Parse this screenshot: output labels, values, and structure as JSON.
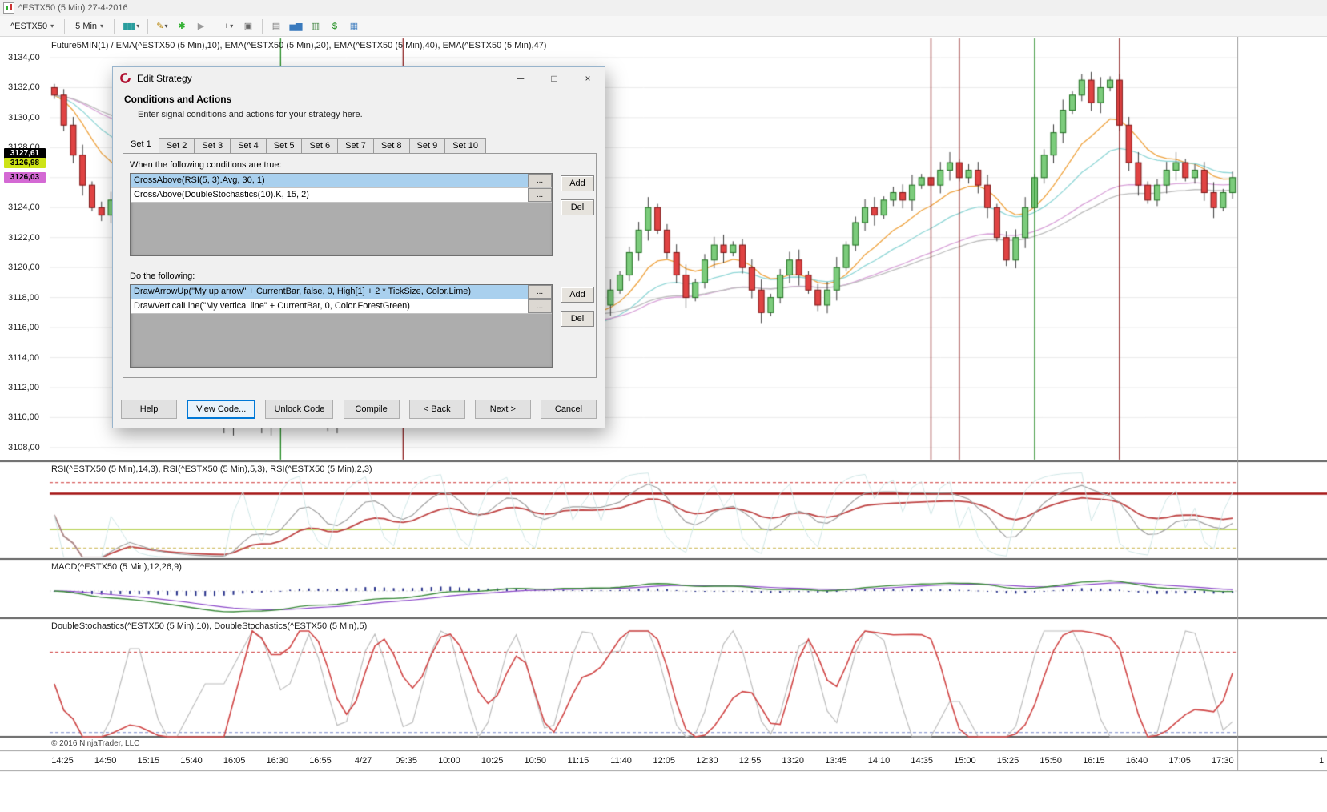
{
  "window": {
    "title": "^ESTX50 (5 Min)  27-4-2016"
  },
  "toolbar": {
    "instrument": "^ESTX50",
    "interval": "5 Min",
    "caret": "▾",
    "icons": [
      {
        "sep": true
      },
      {
        "name": "chart-style-button",
        "glyph": "▮▮▮",
        "color": "#2a9d9d",
        "caret": true
      },
      {
        "sep": true
      },
      {
        "name": "drawing-tools-button",
        "glyph": "✎",
        "color": "#b8860b",
        "caret": true
      },
      {
        "name": "add-indicator-button",
        "glyph": "✱",
        "color": "#2eaf2e",
        "caret": false
      },
      {
        "name": "pointer-button",
        "glyph": "▶",
        "color": "#9a9a9a",
        "caret": false
      },
      {
        "sep": true
      },
      {
        "name": "crosshair-button",
        "glyph": "+",
        "color": "#333333",
        "caret": true
      },
      {
        "name": "snapshot-button",
        "glyph": "▣",
        "color": "#666666",
        "caret": false
      },
      {
        "sep": true
      },
      {
        "name": "window-layout-button",
        "glyph": "▤",
        "color": "#777777",
        "caret": false
      },
      {
        "name": "bar-analyzer-button",
        "glyph": "▅▆",
        "color": "#3a7abd",
        "caret": false
      },
      {
        "name": "export-chart-button",
        "glyph": "▥",
        "color": "#4a8a4a",
        "caret": false
      },
      {
        "name": "chart-trader-button",
        "glyph": "$",
        "color": "#1c8c1c",
        "caret": false
      },
      {
        "name": "data-grid-button",
        "glyph": "▦",
        "color": "#3a7abd",
        "caret": false
      }
    ]
  },
  "chart": {
    "overlay_label": "Future5MIN(1) / EMA(^ESTX50 (5 Min),10), EMA(^ESTX50 (5 Min),20), EMA(^ESTX50 (5 Min),40), EMA(^ESTX50 (5 Min),47)",
    "rsi_label": "RSI(^ESTX50 (5 Min),14,3), RSI(^ESTX50 (5 Min),5,3), RSI(^ESTX50 (5 Min),2,3)",
    "macd_label": "MACD(^ESTX50 (5 Min),12,26,9)",
    "stoch_label": "DoubleStochastics(^ESTX50 (5 Min),10), DoubleStochastics(^ESTX50 (5 Min),5)",
    "copyright": "© 2016 NinjaTrader, LLC",
    "price_axis": [
      "3134,00",
      "3132,00",
      "3130,00",
      "3128,00",
      "3126,00",
      "3124,00",
      "3122,00",
      "3120,00",
      "3118,00",
      "3116,00",
      "3114,00",
      "3112,00",
      "3110,00",
      "3108,00"
    ],
    "price_markers": [
      {
        "label": "3127,61",
        "value": 3127.61,
        "bg": "#000000",
        "fg": "#ffffff"
      },
      {
        "label": "3126,98",
        "value": 3126.98,
        "bg": "#cde317",
        "fg": "#000000"
      },
      {
        "label": "3126,03",
        "value": 3126.03,
        "bg": "#d469d4",
        "fg": "#000000"
      }
    ],
    "time_axis": [
      "14:25",
      "14:50",
      "15:15",
      "15:40",
      "16:05",
      "16:30",
      "16:55",
      "4/27",
      "09:35",
      "10:00",
      "10:25",
      "10:50",
      "11:15",
      "11:40",
      "12:05",
      "12:30",
      "12:55",
      "13:20",
      "13:45",
      "14:10",
      "14:35",
      "15:00",
      "15:25",
      "15:50",
      "16:15",
      "16:40",
      "17:05",
      "17:30",
      "1"
    ]
  },
  "dialog": {
    "title": "Edit Strategy",
    "controls": [
      "─",
      "□",
      "×"
    ],
    "heading": "Conditions and Actions",
    "subheading": "Enter signal conditions and actions for your strategy here.",
    "tabs": [
      "Set 1",
      "Set 2",
      "Set 3",
      "Set 4",
      "Set 5",
      "Set 6",
      "Set 7",
      "Set 8",
      "Set 9",
      "Set 10"
    ],
    "active_tab": "Set 1",
    "conditions_label": "When the following conditions are true:",
    "conditions": [
      "CrossAbove(RSI(5, 3).Avg, 30, 1)",
      "CrossAbove(DoubleStochastics(10).K, 15, 2)"
    ],
    "actions_label": "Do the following:",
    "actions": [
      "DrawArrowUp(\"My up arrow\" + CurrentBar, false, 0, High[1] + 2 * TickSize, Color.Lime)",
      "DrawVerticalLine(\"My vertical line\" + CurrentBar, 0, Color.ForestGreen)"
    ],
    "row_button": "...",
    "add_label": "Add",
    "del_label": "Del",
    "footer_buttons": [
      "Help",
      "View Code...",
      "Unlock Code",
      "Compile",
      "< Back",
      "Next >",
      "Cancel"
    ]
  },
  "chart_data": {
    "type": "candlestick+indicators",
    "ylim": [
      3108,
      3134
    ],
    "closes": [
      3131.5,
      3129.5,
      3127.5,
      3125.5,
      3124.0,
      3123.5,
      3124.5,
      3124.0,
      3123.0,
      3121.5,
      3120.0,
      3118.5,
      3117.0,
      3115.5,
      3114.0,
      3112.5,
      3111.0,
      3110.0,
      3109.5,
      3110.5,
      3111.5,
      3110.5,
      3109.5,
      3110.0,
      3111.0,
      3112.5,
      3113.5,
      3112.0,
      3110.5,
      3109.5,
      3110.5,
      3112.0,
      3113.0,
      3114.5,
      3113.5,
      3112.0,
      3111.0,
      3112.0,
      3113.5,
      3115.0,
      3116.5,
      3117.5,
      3116.5,
      3115.0,
      3114.0,
      3115.0,
      3116.5,
      3117.5,
      3118.5,
      3117.5,
      3116.0,
      3115.0,
      3116.0,
      3117.0,
      3118.0,
      3117.0,
      3117.5,
      3118.0,
      3117.5,
      3118.5,
      3119.5,
      3121.0,
      3122.5,
      3124.0,
      3122.5,
      3121.0,
      3119.5,
      3118.0,
      3119.0,
      3120.5,
      3121.5,
      3121.0,
      3121.5,
      3120.0,
      3118.5,
      3117.0,
      3118.0,
      3119.5,
      3120.5,
      3119.5,
      3118.5,
      3117.5,
      3118.5,
      3120.0,
      3121.5,
      3123.0,
      3124.0,
      3123.5,
      3124.5,
      3125.0,
      3124.5,
      3125.5,
      3126.0,
      3125.5,
      3126.5,
      3127.0,
      3126.0,
      3126.5,
      3125.5,
      3124.0,
      3122.0,
      3120.5,
      3122.0,
      3124.0,
      3126.0,
      3127.5,
      3129.0,
      3130.5,
      3131.5,
      3132.5,
      3131.0,
      3132.0,
      3132.5,
      3129.5,
      3127.0,
      3125.5,
      3124.5,
      3125.5,
      3126.5,
      3127.0,
      3126.0,
      3126.5,
      3125.0,
      3124.0,
      3125.0,
      3126.0
    ],
    "candle_up": {
      "fill": "#7ccc7c",
      "stroke": "#1f6f1f"
    },
    "candle_down": {
      "fill": "#e04343",
      "stroke": "#7a1212"
    },
    "wick_color": "#3a3a3a",
    "emas": [
      {
        "period": 10,
        "color": "#efa33f"
      },
      {
        "period": 20,
        "color": "#8fd6d6"
      },
      {
        "period": 40,
        "color": "#d9a3d9"
      },
      {
        "period": 47,
        "color": "#bdbdbd"
      }
    ],
    "vertical_lines": [
      {
        "index": 24,
        "color": "#228b22"
      },
      {
        "index": 37,
        "color": "#8b1a1a"
      },
      {
        "index": 93,
        "color": "#8b1a1a"
      },
      {
        "index": 96,
        "color": "#8b1a1a"
      },
      {
        "index": 104,
        "color": "#228b22"
      },
      {
        "index": 113,
        "color": "#8b1a1a"
      }
    ],
    "rsi_series": [
      {
        "period": 14,
        "smooth": 3,
        "color": "#bf4545",
        "width": 1.8
      },
      {
        "period": 5,
        "smooth": 3,
        "color": "#9e9e9e",
        "width": 1.2
      },
      {
        "period": 2,
        "smooth": 1,
        "color": "#cfe6e6",
        "width": 1.0
      }
    ],
    "rsi_ref_lines": [
      {
        "value": 88,
        "color": "#cc3333",
        "dash": true,
        "width": 1,
        "full": false
      },
      {
        "value": 75,
        "color": "#a31111",
        "dash": false,
        "width": 2.5,
        "full": true
      },
      {
        "value": 33,
        "color": "#a8c832",
        "dash": false,
        "width": 1.6,
        "full": false
      },
      {
        "value": 11,
        "color": "#c8b44a",
        "dash": true,
        "width": 1,
        "full": false
      }
    ],
    "macd": {
      "fast": 12,
      "slow": 26,
      "signal": 9,
      "line_color": "#3a8a3a",
      "signal_color": "#8a46c8",
      "hist_color": "#26308a"
    },
    "stoch_series": [
      {
        "period": 10,
        "color": "#d04545",
        "width": 1.6
      },
      {
        "period": 5,
        "color": "#bcbcbc",
        "width": 1.2
      }
    ],
    "stoch_ref_lines": [
      {
        "value": 80,
        "color": "#cc3333",
        "dash": true,
        "width": 1
      },
      {
        "value": 4,
        "color": "#7888c8",
        "dash": true,
        "width": 1
      }
    ]
  }
}
